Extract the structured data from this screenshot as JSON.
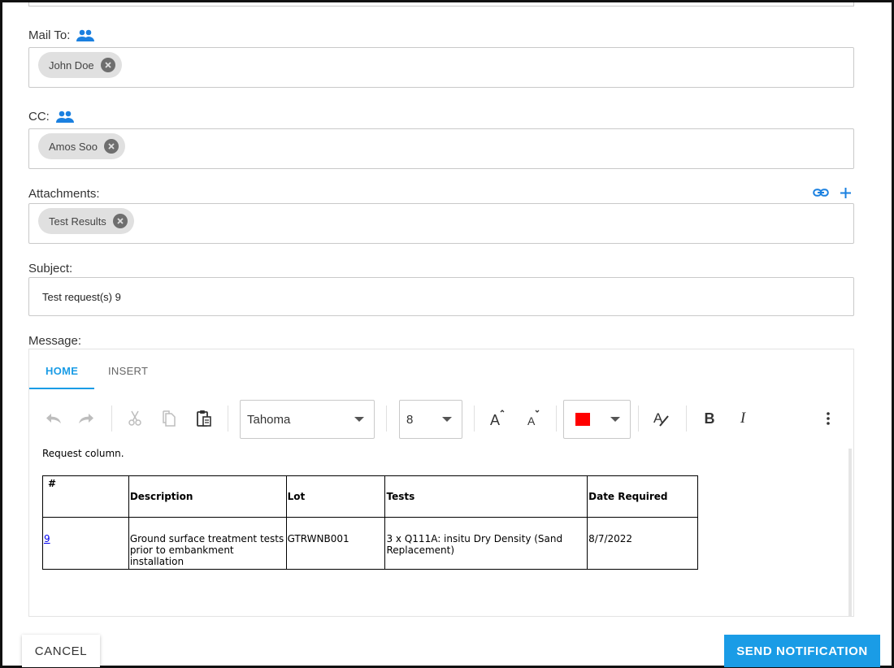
{
  "mail_to": {
    "label": "Mail To:",
    "icon": "people-icon",
    "recipients": [
      "John Doe"
    ]
  },
  "cc": {
    "label": "CC:",
    "icon": "people-icon",
    "recipients": [
      "Amos Soo"
    ]
  },
  "attachments": {
    "label": "Attachments:",
    "items": [
      "Test Results"
    ],
    "link_icon": "link-icon",
    "add_icon": "plus-icon"
  },
  "subject": {
    "label": "Subject:",
    "value": "Test request(s) 9"
  },
  "message": {
    "label": "Message:",
    "tabs": [
      "HOME",
      "INSERT"
    ],
    "active_tab": "HOME",
    "toolbar": {
      "font_name": "Tahoma",
      "font_size": "8",
      "font_color": "#ff0000"
    },
    "body_text": "Request column.",
    "table": {
      "headers": [
        "#",
        "Description",
        "Lot",
        "Tests",
        "Date Required"
      ],
      "rows": [
        [
          "9",
          "Ground surface treatment tests prior to embankment installation",
          "GTRWNB001",
          "3 x Q111A: insitu Dry Density (Sand Replacement)",
          "8/7/2022"
        ]
      ]
    }
  },
  "buttons": {
    "cancel": "CANCEL",
    "send": "SEND NOTIFICATION"
  },
  "colors": {
    "accent": "#1a9ce6",
    "chip_bg": "#e0e0e0"
  }
}
